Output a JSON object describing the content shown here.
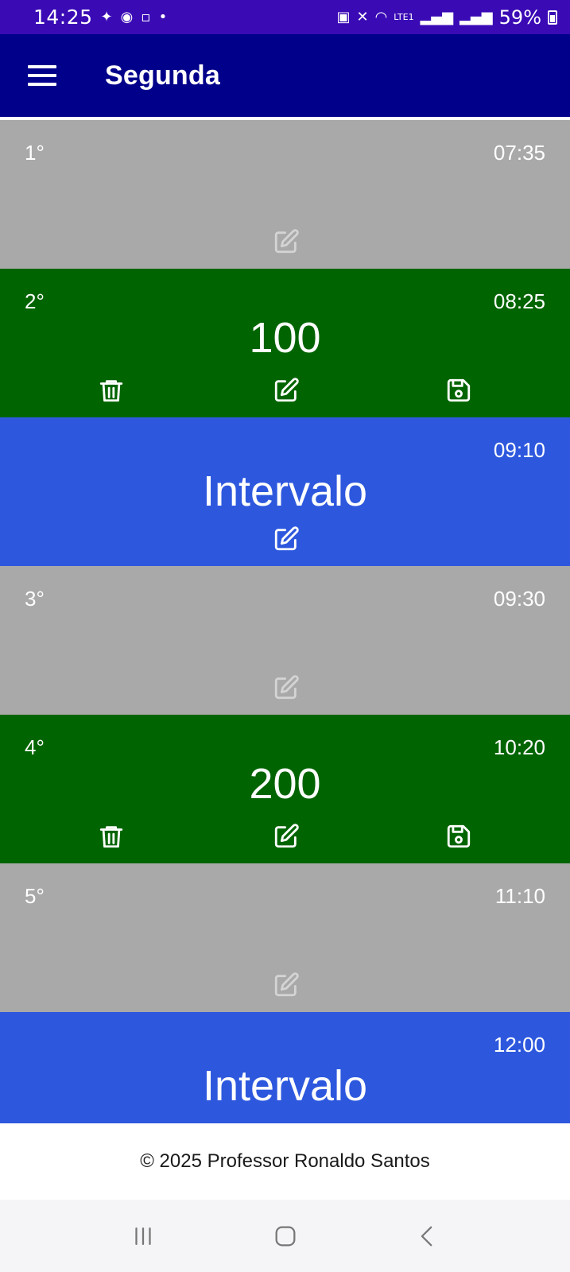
{
  "status_bar": {
    "time": "14:25",
    "battery": "59%",
    "network_label": "LTE1"
  },
  "app_bar": {
    "title": "Segunda"
  },
  "colors": {
    "status_bar": "#3a0ab5",
    "app_bar": "#01008a",
    "empty_slot": "#a9a9a9",
    "filled_slot": "#006400",
    "interval_slot": "#2d58de"
  },
  "schedule": [
    {
      "number": "1°",
      "time": "07:35",
      "content": "",
      "kind": "empty"
    },
    {
      "number": "2°",
      "time": "08:25",
      "content": "100",
      "kind": "filled"
    },
    {
      "number": "",
      "time": "09:10",
      "content": "Intervalo",
      "kind": "interval"
    },
    {
      "number": "3°",
      "time": "09:30",
      "content": "",
      "kind": "empty"
    },
    {
      "number": "4°",
      "time": "10:20",
      "content": "200",
      "kind": "filled"
    },
    {
      "number": "5°",
      "time": "11:10",
      "content": "",
      "kind": "empty"
    },
    {
      "number": "",
      "time": "12:00",
      "content": "Intervalo",
      "kind": "interval"
    }
  ],
  "icons": {
    "edit": "edit-icon",
    "delete": "trash-icon",
    "save": "floppy-disk-icon",
    "menu": "hamburger-menu-icon"
  },
  "footer": {
    "text": "© 2025 Professor Ronaldo Santos"
  }
}
